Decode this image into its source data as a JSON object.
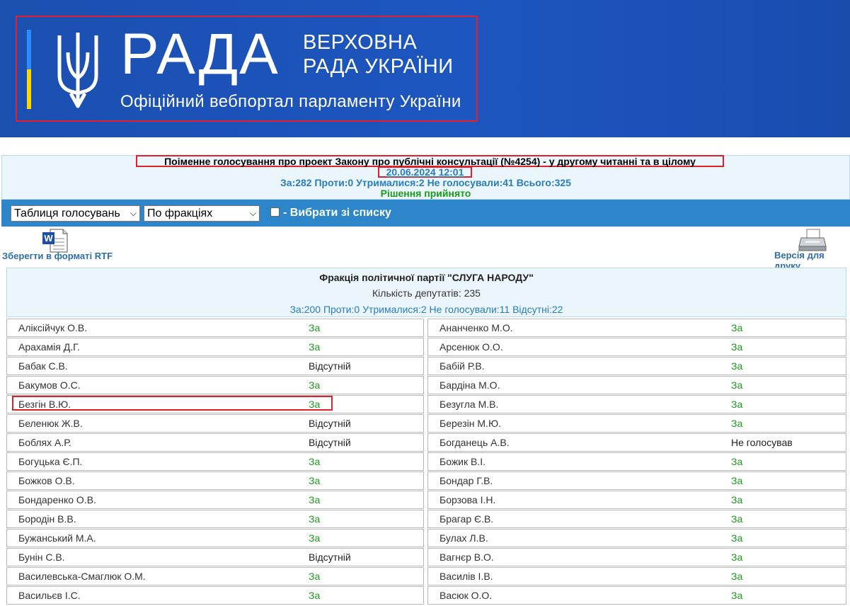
{
  "header": {
    "brand": "РАДА",
    "title_line1": "ВЕРХОВНА",
    "title_line2": "РАДА УКРАЇНИ",
    "subtitle": "Офіційний вебпортал парламенту України",
    "colors": {
      "bg": "#1d56c0",
      "flag_blue": "#2a8cff",
      "flag_yellow": "#ffd500"
    }
  },
  "vote": {
    "title": "Поіменне голосування про проект Закону про публічні консультації (№4254) - у другому читанні та в цілому",
    "date": "20.06.2024 12:01",
    "totals": "За:282 Проти:0 Утрималися:2 Не голосували:41 Всього:325",
    "decision": "Рішення прийнято"
  },
  "filters": {
    "table_select": "Таблиця голосувань",
    "group_select": "По фракціях",
    "choose_label": "- Вибрати зі списку"
  },
  "actions": {
    "save_rtf": "Зберегти в форматі RTF",
    "print_version": "Версія для друку"
  },
  "faction": {
    "name": "Фракція політичної партії \"СЛУГА НАРОДУ\"",
    "count": "Кількість депутатів: 235",
    "summary": "За:200 Проти:0 Утрималися:2 Не голосували:11 Відсутні:22"
  },
  "deputies": [
    [
      "Аліксійчук О.В.",
      "За",
      "Ананченко М.О.",
      "За"
    ],
    [
      "Арахамія Д.Г.",
      "За",
      "Арсенюк О.О.",
      "За"
    ],
    [
      "Бабак С.В.",
      "Відсутній",
      "Бабій Р.В.",
      "За"
    ],
    [
      "Бакумов О.С.",
      "За",
      "Бардіна М.О.",
      "За"
    ],
    [
      "Безгін В.Ю.",
      "За",
      "Безугла М.В.",
      "За"
    ],
    [
      "Беленюк Ж.В.",
      "Відсутній",
      "Березін М.Ю.",
      "За"
    ],
    [
      "Боблях А.Р.",
      "Відсутній",
      "Богданець А.В.",
      "Не голосував"
    ],
    [
      "Богуцька Є.П.",
      "За",
      "Божик В.І.",
      "За"
    ],
    [
      "Божков О.В.",
      "За",
      "Бондар Г.В.",
      "За"
    ],
    [
      "Бондаренко О.В.",
      "За",
      "Борзова І.Н.",
      "За"
    ],
    [
      "Бородін В.В.",
      "За",
      "Брагар Є.В.",
      "За"
    ],
    [
      "Бужанський М.А.",
      "За",
      "Булах Л.В.",
      "За"
    ],
    [
      "Бунін С.В.",
      "Відсутній",
      "Вагнєр В.О.",
      "За"
    ],
    [
      "Василевська-Смаглюк О.М.",
      "За",
      "Василів І.В.",
      "За"
    ],
    [
      "Васильєв І.С.",
      "За",
      "Васюк О.О.",
      "За"
    ]
  ]
}
